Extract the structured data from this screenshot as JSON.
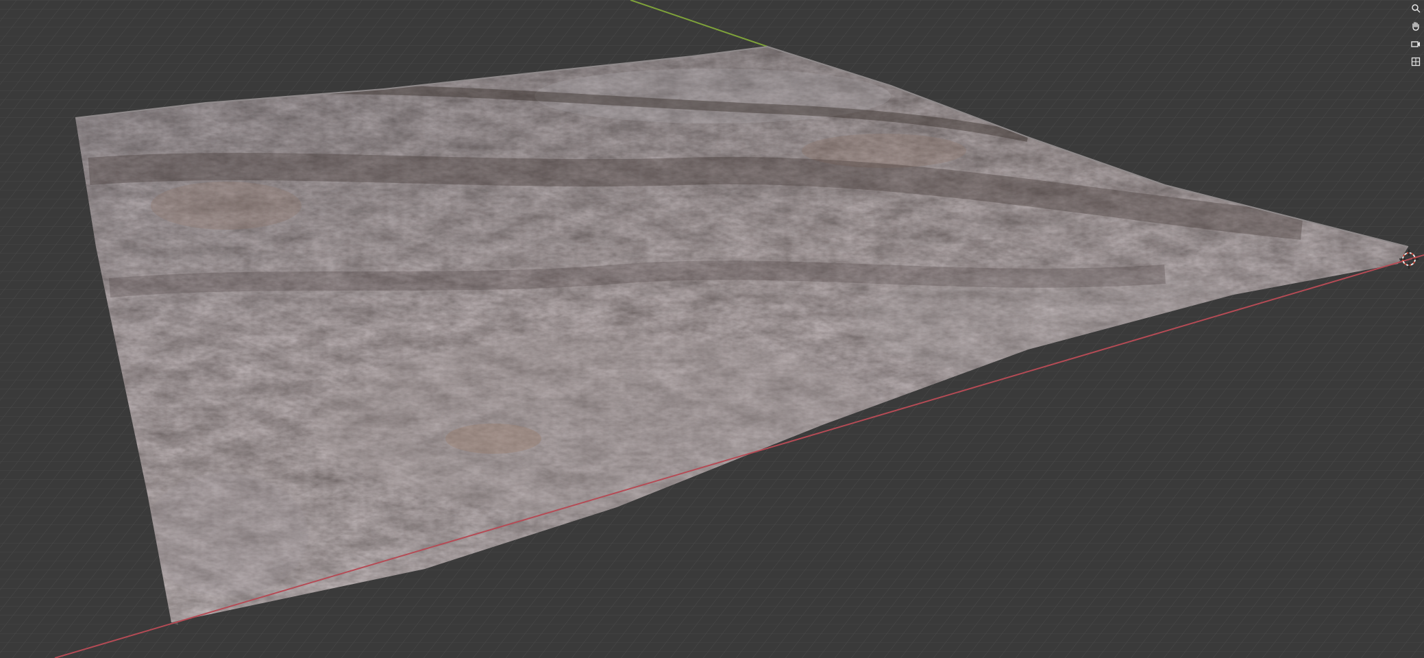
{
  "viewport": {
    "background_color": "#3a3a3a",
    "grid_line_color": "#4b4b4b",
    "x_axis_color": "#b54b55",
    "y_axis_color": "#7ea23a",
    "terrain_base_color": "#6f6a6e",
    "terrain_highlight_color": "#9c979a",
    "terrain_shadow_color": "#3f3532",
    "terrain_tan_color": "#8a766c"
  },
  "nav_tools": [
    {
      "icon": "zoom-icon"
    },
    {
      "icon": "hand-pan-icon"
    },
    {
      "icon": "camera-icon"
    },
    {
      "icon": "orthographic-grid-icon"
    }
  ],
  "scene": {
    "object_icon": "terrain-mesh",
    "origin_icon": "3d-cursor-icon"
  }
}
